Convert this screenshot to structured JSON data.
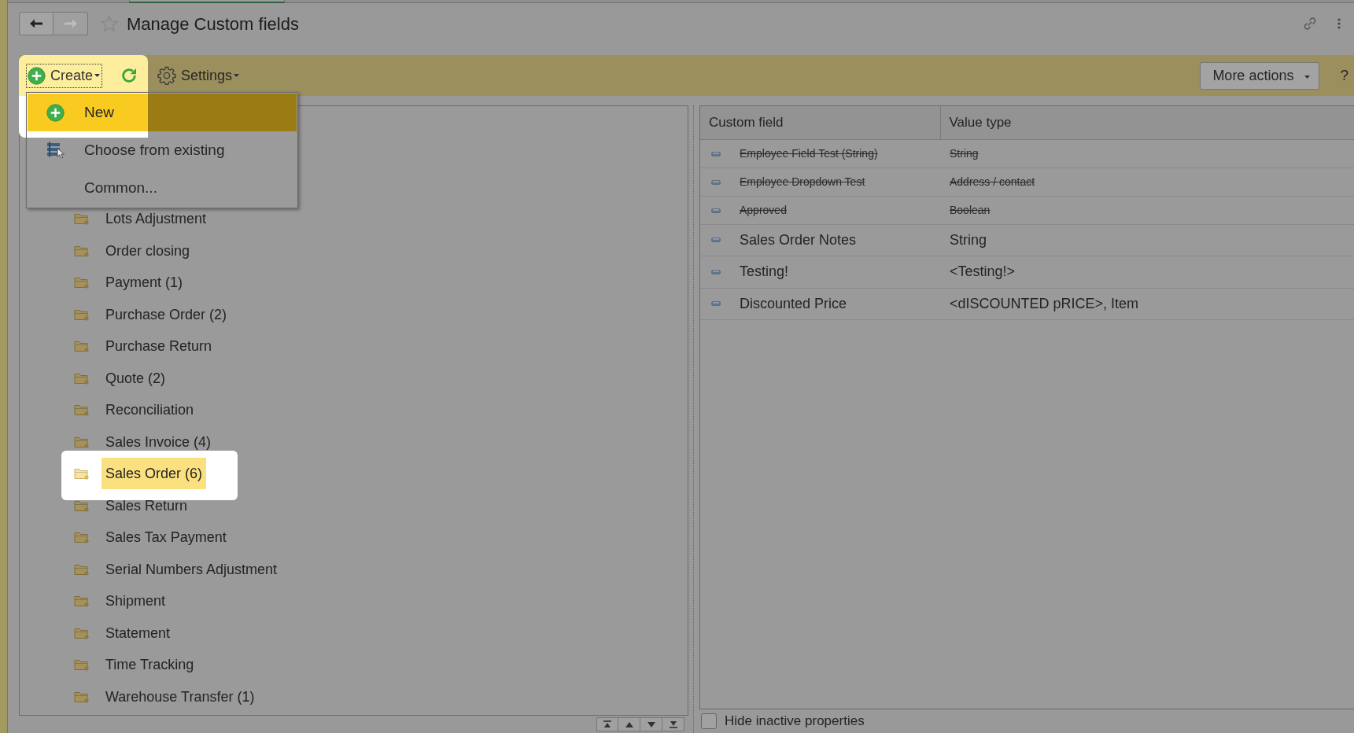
{
  "window": {
    "title": "Manage Custom fields",
    "favorite": false
  },
  "navigation": [
    {
      "kind": "back",
      "disabled": false
    },
    {
      "kind": "forward",
      "disabled": true
    }
  ],
  "toolbar": {
    "create": {
      "label": "Create",
      "focused": true,
      "spotlight": true
    },
    "settings": {
      "label": "Settings"
    },
    "more_actions": {
      "label": "More actions"
    },
    "help": "?"
  },
  "create_menu": [
    {
      "kind": "new",
      "label": "New",
      "selected": true
    },
    {
      "kind": "existing",
      "label": "Choose from existing",
      "selected": false
    },
    {
      "kind": "plain",
      "label": "Common...",
      "selected": false
    }
  ],
  "tree": {
    "items": [
      {
        "label": "Lots Adjustment",
        "selected": false,
        "spotlight": false
      },
      {
        "label": "Order closing",
        "selected": false,
        "spotlight": false
      },
      {
        "label": "Payment (1)",
        "selected": false,
        "spotlight": false
      },
      {
        "label": "Purchase Order (2)",
        "selected": false,
        "spotlight": false
      },
      {
        "label": "Purchase Return",
        "selected": false,
        "spotlight": false
      },
      {
        "label": "Quote (2)",
        "selected": false,
        "spotlight": false
      },
      {
        "label": "Reconciliation",
        "selected": false,
        "spotlight": false
      },
      {
        "label": "Sales Invoice (4)",
        "selected": false,
        "spotlight": false
      },
      {
        "label": "Sales Order (6)",
        "selected": true,
        "spotlight": true
      },
      {
        "label": "Sales Return",
        "selected": false,
        "spotlight": false
      },
      {
        "label": "Sales Tax Payment",
        "selected": false,
        "spotlight": false
      },
      {
        "label": "Serial Numbers Adjustment",
        "selected": false,
        "spotlight": false
      },
      {
        "label": "Shipment",
        "selected": false,
        "spotlight": false
      },
      {
        "label": "Statement",
        "selected": false,
        "spotlight": false
      },
      {
        "label": "Time Tracking",
        "selected": false,
        "spotlight": false
      },
      {
        "label": "Warehouse Transfer (1)",
        "selected": false,
        "spotlight": false
      }
    ]
  },
  "table": {
    "columns": [
      "Custom field",
      "Value type"
    ],
    "rows": [
      {
        "custom_field": "Employee Field Test (String)",
        "value_type": "String",
        "deleted": true
      },
      {
        "custom_field": "Employee Dropdown Test",
        "value_type": "Address / contact",
        "deleted": true
      },
      {
        "custom_field": "Approved",
        "value_type": "Boolean",
        "deleted": true
      },
      {
        "custom_field": "Sales Order Notes",
        "value_type": "String",
        "deleted": false
      },
      {
        "custom_field": "Testing!",
        "value_type": "<Testing!>",
        "deleted": false
      },
      {
        "custom_field": "Discounted Price",
        "value_type": "<dISCOUNTED pRICE>, Item",
        "deleted": false
      }
    ]
  },
  "hide_inactive": {
    "label": "Hide inactive properties",
    "checked": false
  }
}
